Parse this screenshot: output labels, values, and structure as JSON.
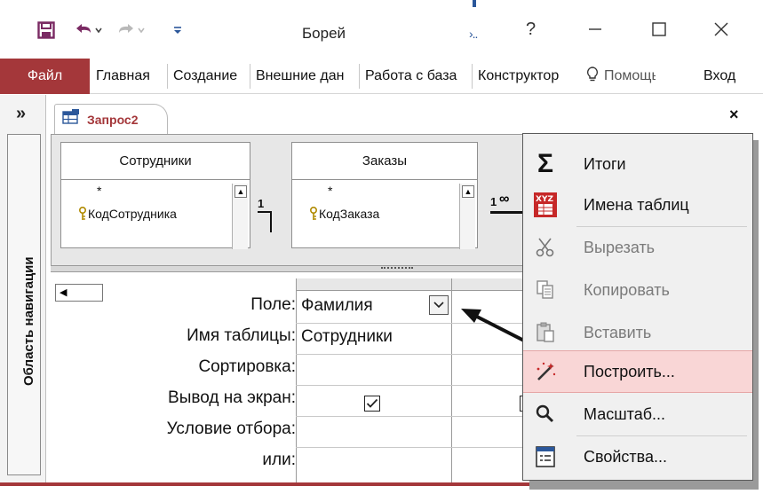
{
  "app": {
    "title": "Борей",
    "context_tab_hint": "›..",
    "help_button": "?"
  },
  "ribbon": {
    "file": "Файл",
    "tabs": [
      "Главная",
      "Создание",
      "Внешние дан",
      "Работа с база",
      "Конструктор"
    ],
    "help_search": "Помощь",
    "login": "Вход"
  },
  "nav_pane": {
    "toggle": "»",
    "label": "Область навигации"
  },
  "document": {
    "tab_label": "Запрос2",
    "close": "×"
  },
  "field_lists": [
    {
      "title": "Сотрудники",
      "all_fields": "*",
      "key_field": "КодСотрудника"
    },
    {
      "title": "Заказы",
      "all_fields": "*",
      "key_field": "КодЗаказа"
    }
  ],
  "relationships": {
    "one_label_1": "1",
    "one_label_2": "1"
  },
  "design_grid": {
    "row_labels": [
      "Поле:",
      "Имя таблицы:",
      "Сортировка:",
      "Вывод на экран:",
      "Условие отбора:",
      "или:"
    ],
    "column_1": {
      "field": "Фамилия",
      "table": "Сотрудники",
      "show": true
    }
  },
  "context_menu": {
    "items": [
      {
        "label": "Итоги",
        "icon": "sigma-icon",
        "enabled": true
      },
      {
        "label": "Имена таблиц",
        "icon": "table-names-icon",
        "enabled": true
      },
      {
        "label": "Вырезать",
        "icon": "scissors-icon",
        "enabled": false
      },
      {
        "label": "Копировать",
        "icon": "copy-icon",
        "enabled": false
      },
      {
        "label": "Вставить",
        "icon": "paste-icon",
        "enabled": false
      },
      {
        "label": "Построить...",
        "icon": "build-wand-icon",
        "enabled": true,
        "highlighted": true
      },
      {
        "label": "Масштаб...",
        "icon": "zoom-icon",
        "enabled": true
      },
      {
        "label": "Свойства...",
        "icon": "properties-icon",
        "enabled": true
      }
    ]
  },
  "colors": {
    "access_accent": "#a4373a",
    "highlight": "#f9d6d6",
    "context_blue": "#2b579a"
  }
}
